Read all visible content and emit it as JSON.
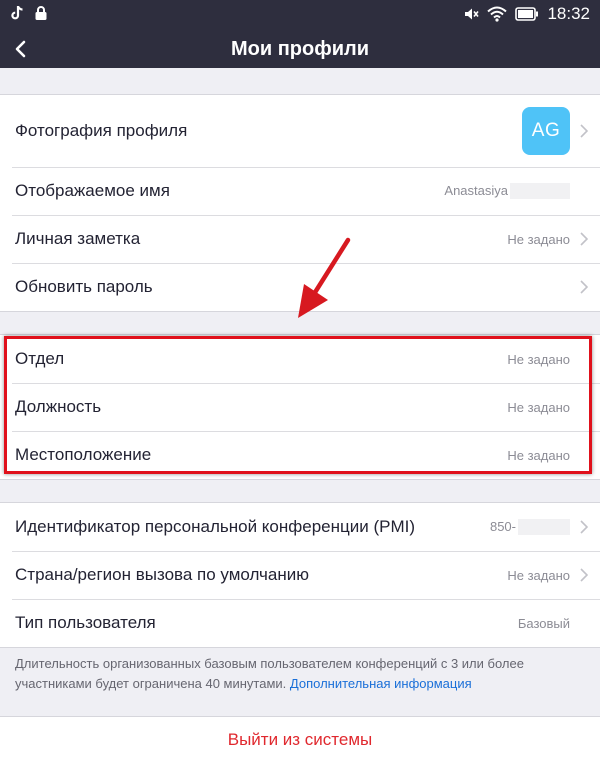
{
  "statusbar": {
    "time": "18:32"
  },
  "header": {
    "title": "Мои профили"
  },
  "profile": {
    "photo_label": "Фотография профиля",
    "avatar_initials": "AG",
    "display_name_label": "Отображаемое имя",
    "display_name_value": "Anastasiya",
    "note_label": "Личная заметка",
    "note_value": "Не задано",
    "password_label": "Обновить пароль"
  },
  "work": {
    "department_label": "Отдел",
    "department_value": "Не задано",
    "position_label": "Должность",
    "position_value": "Не задано",
    "location_label": "Местоположение",
    "location_value": "Не задано"
  },
  "account": {
    "pmi_label": "Идентификатор персональной конференции (PMI)",
    "pmi_value": "850-",
    "country_label": "Страна/регион вызова по умолчанию",
    "country_value": "Не задано",
    "user_type_label": "Тип пользователя",
    "user_type_value": "Базовый"
  },
  "footnote": {
    "text": "Длительность организованных базовым пользователем конференций с 3 или более участниками будет ограничена 40 минутами.",
    "link": "Дополнительная информация"
  },
  "signout_label": "Выйти из системы",
  "colors": {
    "header_bg": "#2e2e3e",
    "avatar_bg": "#4fc3f7",
    "link": "#1a6fd8",
    "signout": "#e0282e",
    "annotation": "#e0111b"
  }
}
